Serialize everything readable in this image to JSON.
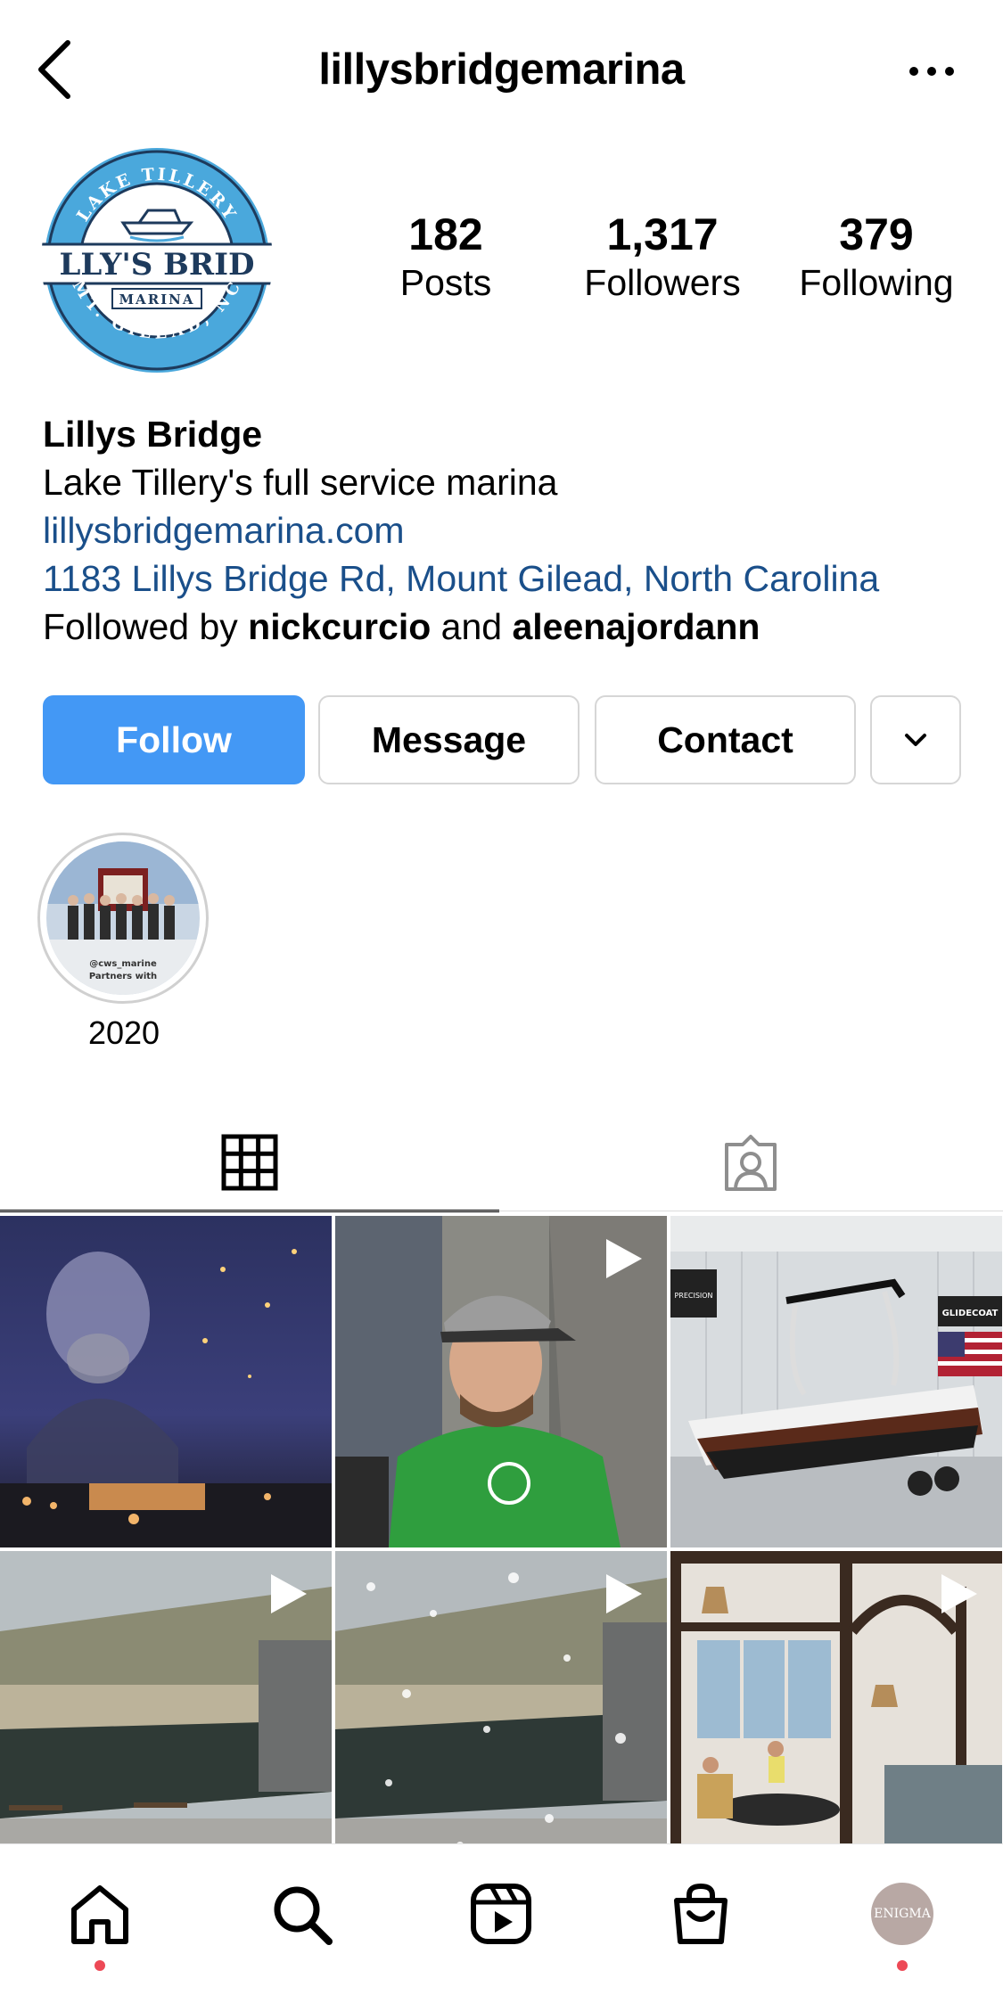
{
  "header": {
    "username": "lillysbridgemarina"
  },
  "profile": {
    "avatar_logo": {
      "top_text": "LAKE TILLERY",
      "main_text": "LLY'S BRID",
      "sub_text": "MARINA",
      "bottom_text": "MT. GILEAD, NC"
    },
    "stats": {
      "posts": {
        "value": "182",
        "label": "Posts"
      },
      "followers": {
        "value": "1,317",
        "label": "Followers"
      },
      "following": {
        "value": "379",
        "label": "Following"
      }
    }
  },
  "bio": {
    "name": "Lillys Bridge",
    "description": "Lake Tillery's full service marina",
    "website": "lillysbridgemarina.com",
    "address": "1183 Lillys Bridge Rd, Mount Gilead, North Carolina",
    "followed_by_prefix": "Followed by ",
    "followed_by_user1": "nickcurcio",
    "followed_by_and": " and ",
    "followed_by_user2": "aleenajordann"
  },
  "actions": {
    "follow": "Follow",
    "message": "Message",
    "contact": "Contact"
  },
  "highlights": [
    {
      "label": "2020",
      "caption_line1": "@cws_marine",
      "caption_line2": "Partners with"
    }
  ],
  "tabs": [
    {
      "name": "posts-grid",
      "icon": "grid-icon",
      "active": true
    },
    {
      "name": "tagged",
      "icon": "tagged-user-icon",
      "active": false
    }
  ],
  "grid_posts": [
    {
      "kind": "photo",
      "desc": "man-night-lake"
    },
    {
      "kind": "reel",
      "desc": "man-green-shirt"
    },
    {
      "kind": "photo",
      "desc": "boat-showroom",
      "sign1": "PRECISION",
      "sign2": "GLIDECOAT"
    },
    {
      "kind": "reel",
      "desc": "warehouse"
    },
    {
      "kind": "reel",
      "desc": "warehouse-snow"
    },
    {
      "kind": "reel",
      "desc": "restaurant-interior"
    }
  ],
  "bottom_nav": [
    {
      "name": "home",
      "icon": "home-icon",
      "dot": true
    },
    {
      "name": "search",
      "icon": "search-icon",
      "dot": false
    },
    {
      "name": "reels",
      "icon": "reels-icon",
      "dot": false
    },
    {
      "name": "shop",
      "icon": "shopping-bag-icon",
      "dot": false
    },
    {
      "name": "profile",
      "icon": "profile-avatar",
      "dot": true,
      "avatar_text": "ENIGMA"
    }
  ],
  "colors": {
    "accent_blue": "#4398f5",
    "link_blue": "#1a4f8a",
    "notification_red": "#ed4956",
    "logo_blue": "#4aa8dc"
  }
}
